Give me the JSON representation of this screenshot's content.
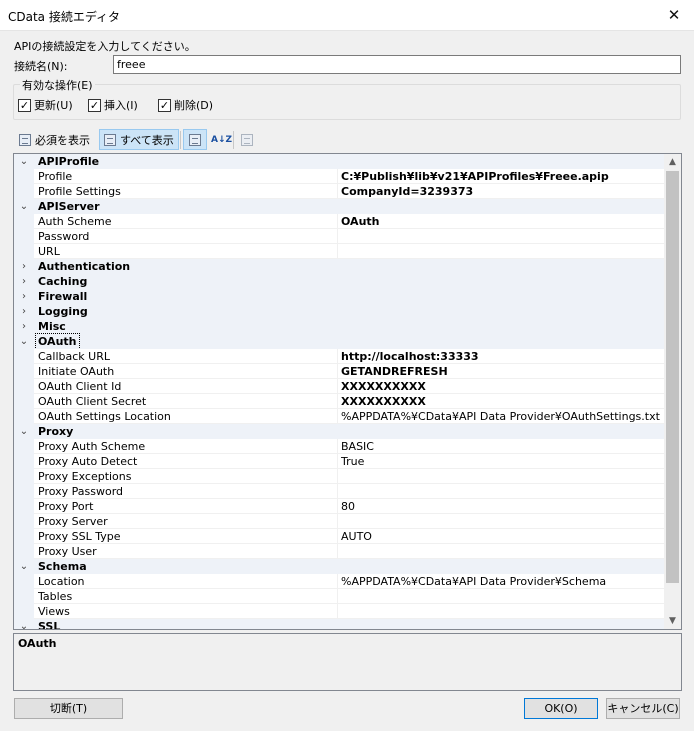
{
  "window": {
    "title": "CData 接続エディタ",
    "close_glyph": "✕"
  },
  "instruction": "APIの接続設定を入力してください。",
  "connection": {
    "label": "接続名(N):",
    "value": "freee"
  },
  "operations": {
    "legend": "有効な操作(E)",
    "items": [
      {
        "label": "更新(U)",
        "checked": "✓"
      },
      {
        "label": "挿入(I)",
        "checked": "✓"
      },
      {
        "label": "削除(D)",
        "checked": "✓"
      }
    ]
  },
  "toolbar": {
    "required_label": "必須を表示",
    "all_label": "すべて表示",
    "sort_az_icon": "A↓Z"
  },
  "grid": {
    "rows": [
      {
        "type": "cat",
        "label": "APIProfile",
        "expander": "⌄"
      },
      {
        "type": "prop",
        "name": "Profile",
        "value": "C:¥Publish¥lib¥v21¥APIProfiles¥Freee.apip",
        "bold": true
      },
      {
        "type": "prop",
        "name": "Profile Settings",
        "value": "CompanyId=3239373",
        "bold": true
      },
      {
        "type": "cat",
        "label": "APIServer",
        "expander": "⌄"
      },
      {
        "type": "prop",
        "name": "Auth Scheme",
        "value": "OAuth",
        "bold": true
      },
      {
        "type": "prop",
        "name": "Password",
        "value": "",
        "bold": false
      },
      {
        "type": "prop",
        "name": "URL",
        "value": "",
        "bold": false
      },
      {
        "type": "cat",
        "label": "Authentication",
        "expander": "›"
      },
      {
        "type": "cat",
        "label": "Caching",
        "expander": "›"
      },
      {
        "type": "cat",
        "label": "Firewall",
        "expander": "›"
      },
      {
        "type": "cat",
        "label": "Logging",
        "expander": "›"
      },
      {
        "type": "cat",
        "label": "Misc",
        "expander": "›"
      },
      {
        "type": "cat",
        "label": "OAuth",
        "expander": "⌄",
        "selected": true
      },
      {
        "type": "prop",
        "name": "Callback URL",
        "value": "http://localhost:33333",
        "bold": true
      },
      {
        "type": "prop",
        "name": "Initiate OAuth",
        "value": "GETANDREFRESH",
        "bold": true
      },
      {
        "type": "prop",
        "name": "OAuth Client Id",
        "value": "XXXXXXXXXX",
        "bold": true
      },
      {
        "type": "prop",
        "name": "OAuth Client Secret",
        "value": "XXXXXXXXXX",
        "bold": true
      },
      {
        "type": "prop",
        "name": "OAuth Settings Location",
        "value": "%APPDATA%¥CData¥API Data Provider¥OAuthSettings.txt",
        "bold": false
      },
      {
        "type": "cat",
        "label": "Proxy",
        "expander": "⌄"
      },
      {
        "type": "prop",
        "name": "Proxy Auth Scheme",
        "value": "BASIC",
        "bold": false
      },
      {
        "type": "prop",
        "name": "Proxy Auto Detect",
        "value": "True",
        "bold": false
      },
      {
        "type": "prop",
        "name": "Proxy Exceptions",
        "value": "",
        "bold": false
      },
      {
        "type": "prop",
        "name": "Proxy Password",
        "value": "",
        "bold": false
      },
      {
        "type": "prop",
        "name": "Proxy Port",
        "value": "80",
        "bold": false
      },
      {
        "type": "prop",
        "name": "Proxy Server",
        "value": "",
        "bold": false
      },
      {
        "type": "prop",
        "name": "Proxy SSL Type",
        "value": "AUTO",
        "bold": false
      },
      {
        "type": "prop",
        "name": "Proxy User",
        "value": "",
        "bold": false
      },
      {
        "type": "cat",
        "label": "Schema",
        "expander": "⌄"
      },
      {
        "type": "prop",
        "name": "Location",
        "value": "%APPDATA%¥CData¥API Data Provider¥Schema",
        "bold": false
      },
      {
        "type": "prop",
        "name": "Tables",
        "value": "",
        "bold": false
      },
      {
        "type": "prop",
        "name": "Views",
        "value": "",
        "bold": false
      },
      {
        "type": "cat",
        "label": "SSL",
        "expander": "⌄"
      }
    ],
    "scroll_up": "▲",
    "scroll_down": "▼"
  },
  "description": {
    "title": "OAuth"
  },
  "buttons": {
    "disconnect": "切断(T)",
    "ok": "OK(O)",
    "cancel": "キャンセル(C)"
  }
}
